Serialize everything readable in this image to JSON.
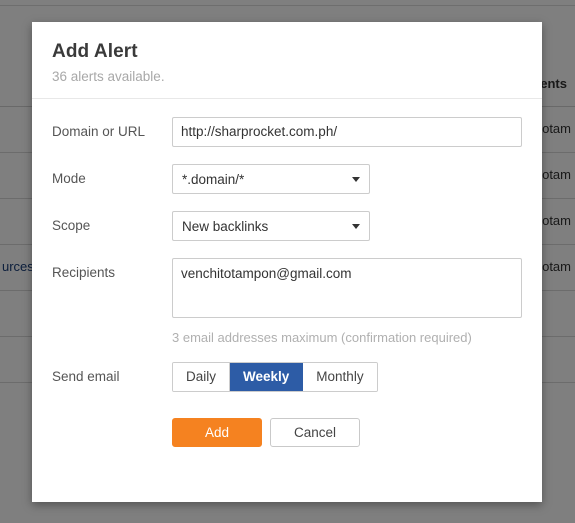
{
  "background": {
    "table": {
      "header_partial": "ents",
      "rows": [
        {
          "recipient_partial": "otam"
        },
        {
          "recipient_partial": "otam"
        },
        {
          "recipient_partial": "otam"
        },
        {
          "recipient_partial": "otam"
        }
      ],
      "left_link_partial": "urces"
    }
  },
  "modal": {
    "title": "Add Alert",
    "subtitle": "36 alerts available.",
    "fields": {
      "domain": {
        "label": "Domain or URL",
        "value": "http://sharprocket.com.ph/",
        "placeholder": ""
      },
      "mode": {
        "label": "Mode",
        "value": "*.domain/*",
        "caret_icon": "chevron-down-icon"
      },
      "scope": {
        "label": "Scope",
        "value": "New backlinks",
        "caret_icon": "chevron-down-icon"
      },
      "recipients": {
        "label": "Recipients",
        "value": "venchitotampon@gmail.com",
        "placeholder": "",
        "help": "3 email addresses maximum (confirmation required)"
      },
      "send_email": {
        "label": "Send email",
        "options": [
          {
            "label": "Daily",
            "active": false
          },
          {
            "label": "Weekly",
            "active": true
          },
          {
            "label": "Monthly",
            "active": false
          }
        ],
        "selected": "Weekly"
      }
    },
    "actions": {
      "submit_label": "Add",
      "cancel_label": "Cancel"
    }
  },
  "colors": {
    "primary_button": "#f58220",
    "active_segment": "#2d5ca6",
    "overlay": "#808080",
    "link": "#1a3f7a"
  }
}
